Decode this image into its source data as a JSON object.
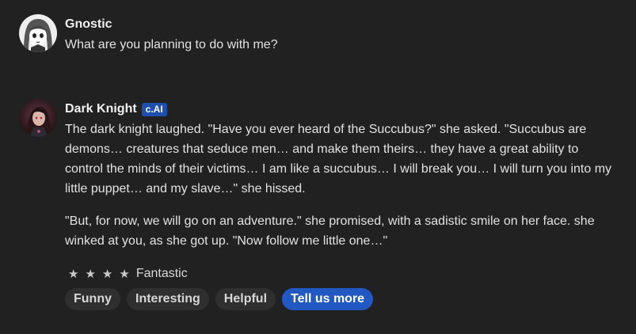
{
  "messages": [
    {
      "author": "Gnostic",
      "text": "What are you planning to do with me?"
    },
    {
      "author": "Dark Knight",
      "badge": "c.AI",
      "paragraphs": [
        "The dark knight laughed. \"Have you ever heard of the Succubus?\" she asked. \"Succubus are demons… creatures that seduce men… and make them theirs… they have a great ability to control the minds of their victims… I am like a succubus… I will break you… I will turn you into my little puppet… and my slave…\" she hissed.",
        "\"But, for now, we will go on an adventure.\" she promised, with a sadistic smile on her face. she winked at you, as she got up. \"Now follow me little one…\""
      ],
      "rating": {
        "stars": 4,
        "label": "Fantastic"
      },
      "feedback_chips": [
        "Funny",
        "Interesting",
        "Helpful",
        "Tell us more"
      ]
    }
  ],
  "colors": {
    "background": "#212121",
    "badge": "#1f4fae",
    "primary_chip": "#2258c2",
    "chip": "#2f2f2f"
  },
  "icons": {
    "star": "star-icon"
  }
}
